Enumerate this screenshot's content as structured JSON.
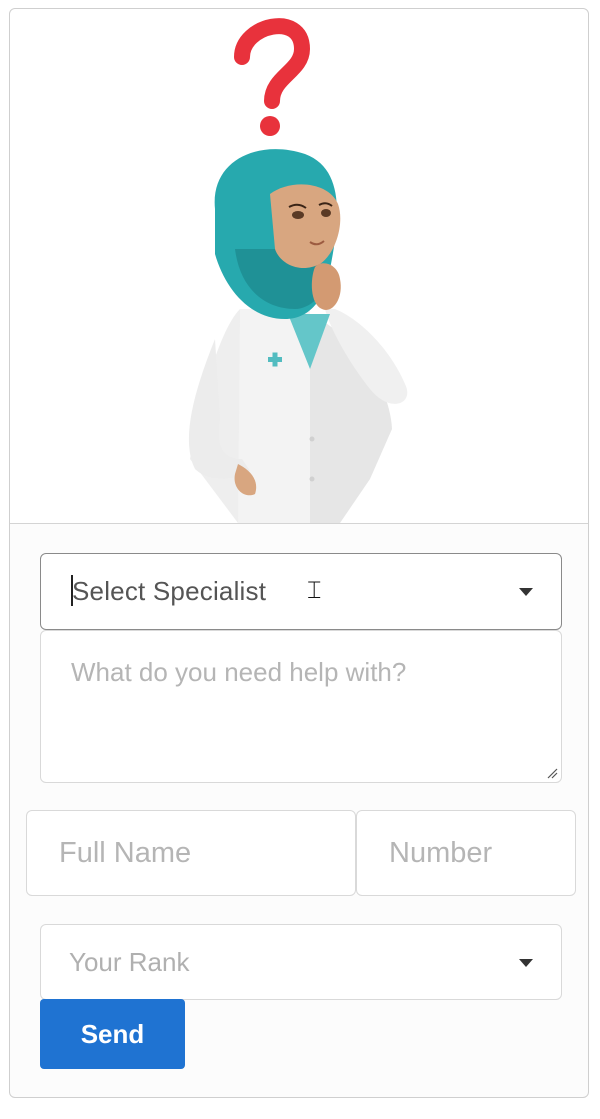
{
  "specialist_select": {
    "selected_label": "Select Specialist"
  },
  "help_request": {
    "placeholder": "What do you need help with?"
  },
  "full_name": {
    "placeholder": "Full Name"
  },
  "number": {
    "placeholder": "Number"
  },
  "rank_select": {
    "selected_label": "Your Rank"
  },
  "send_button": {
    "label": "Send"
  },
  "colors": {
    "primary_button": "#1f73d2",
    "question_mark": "#e8323c",
    "hijab": "#27a9ae"
  },
  "illustration": {
    "icon": "doctor-thinking-icon"
  }
}
